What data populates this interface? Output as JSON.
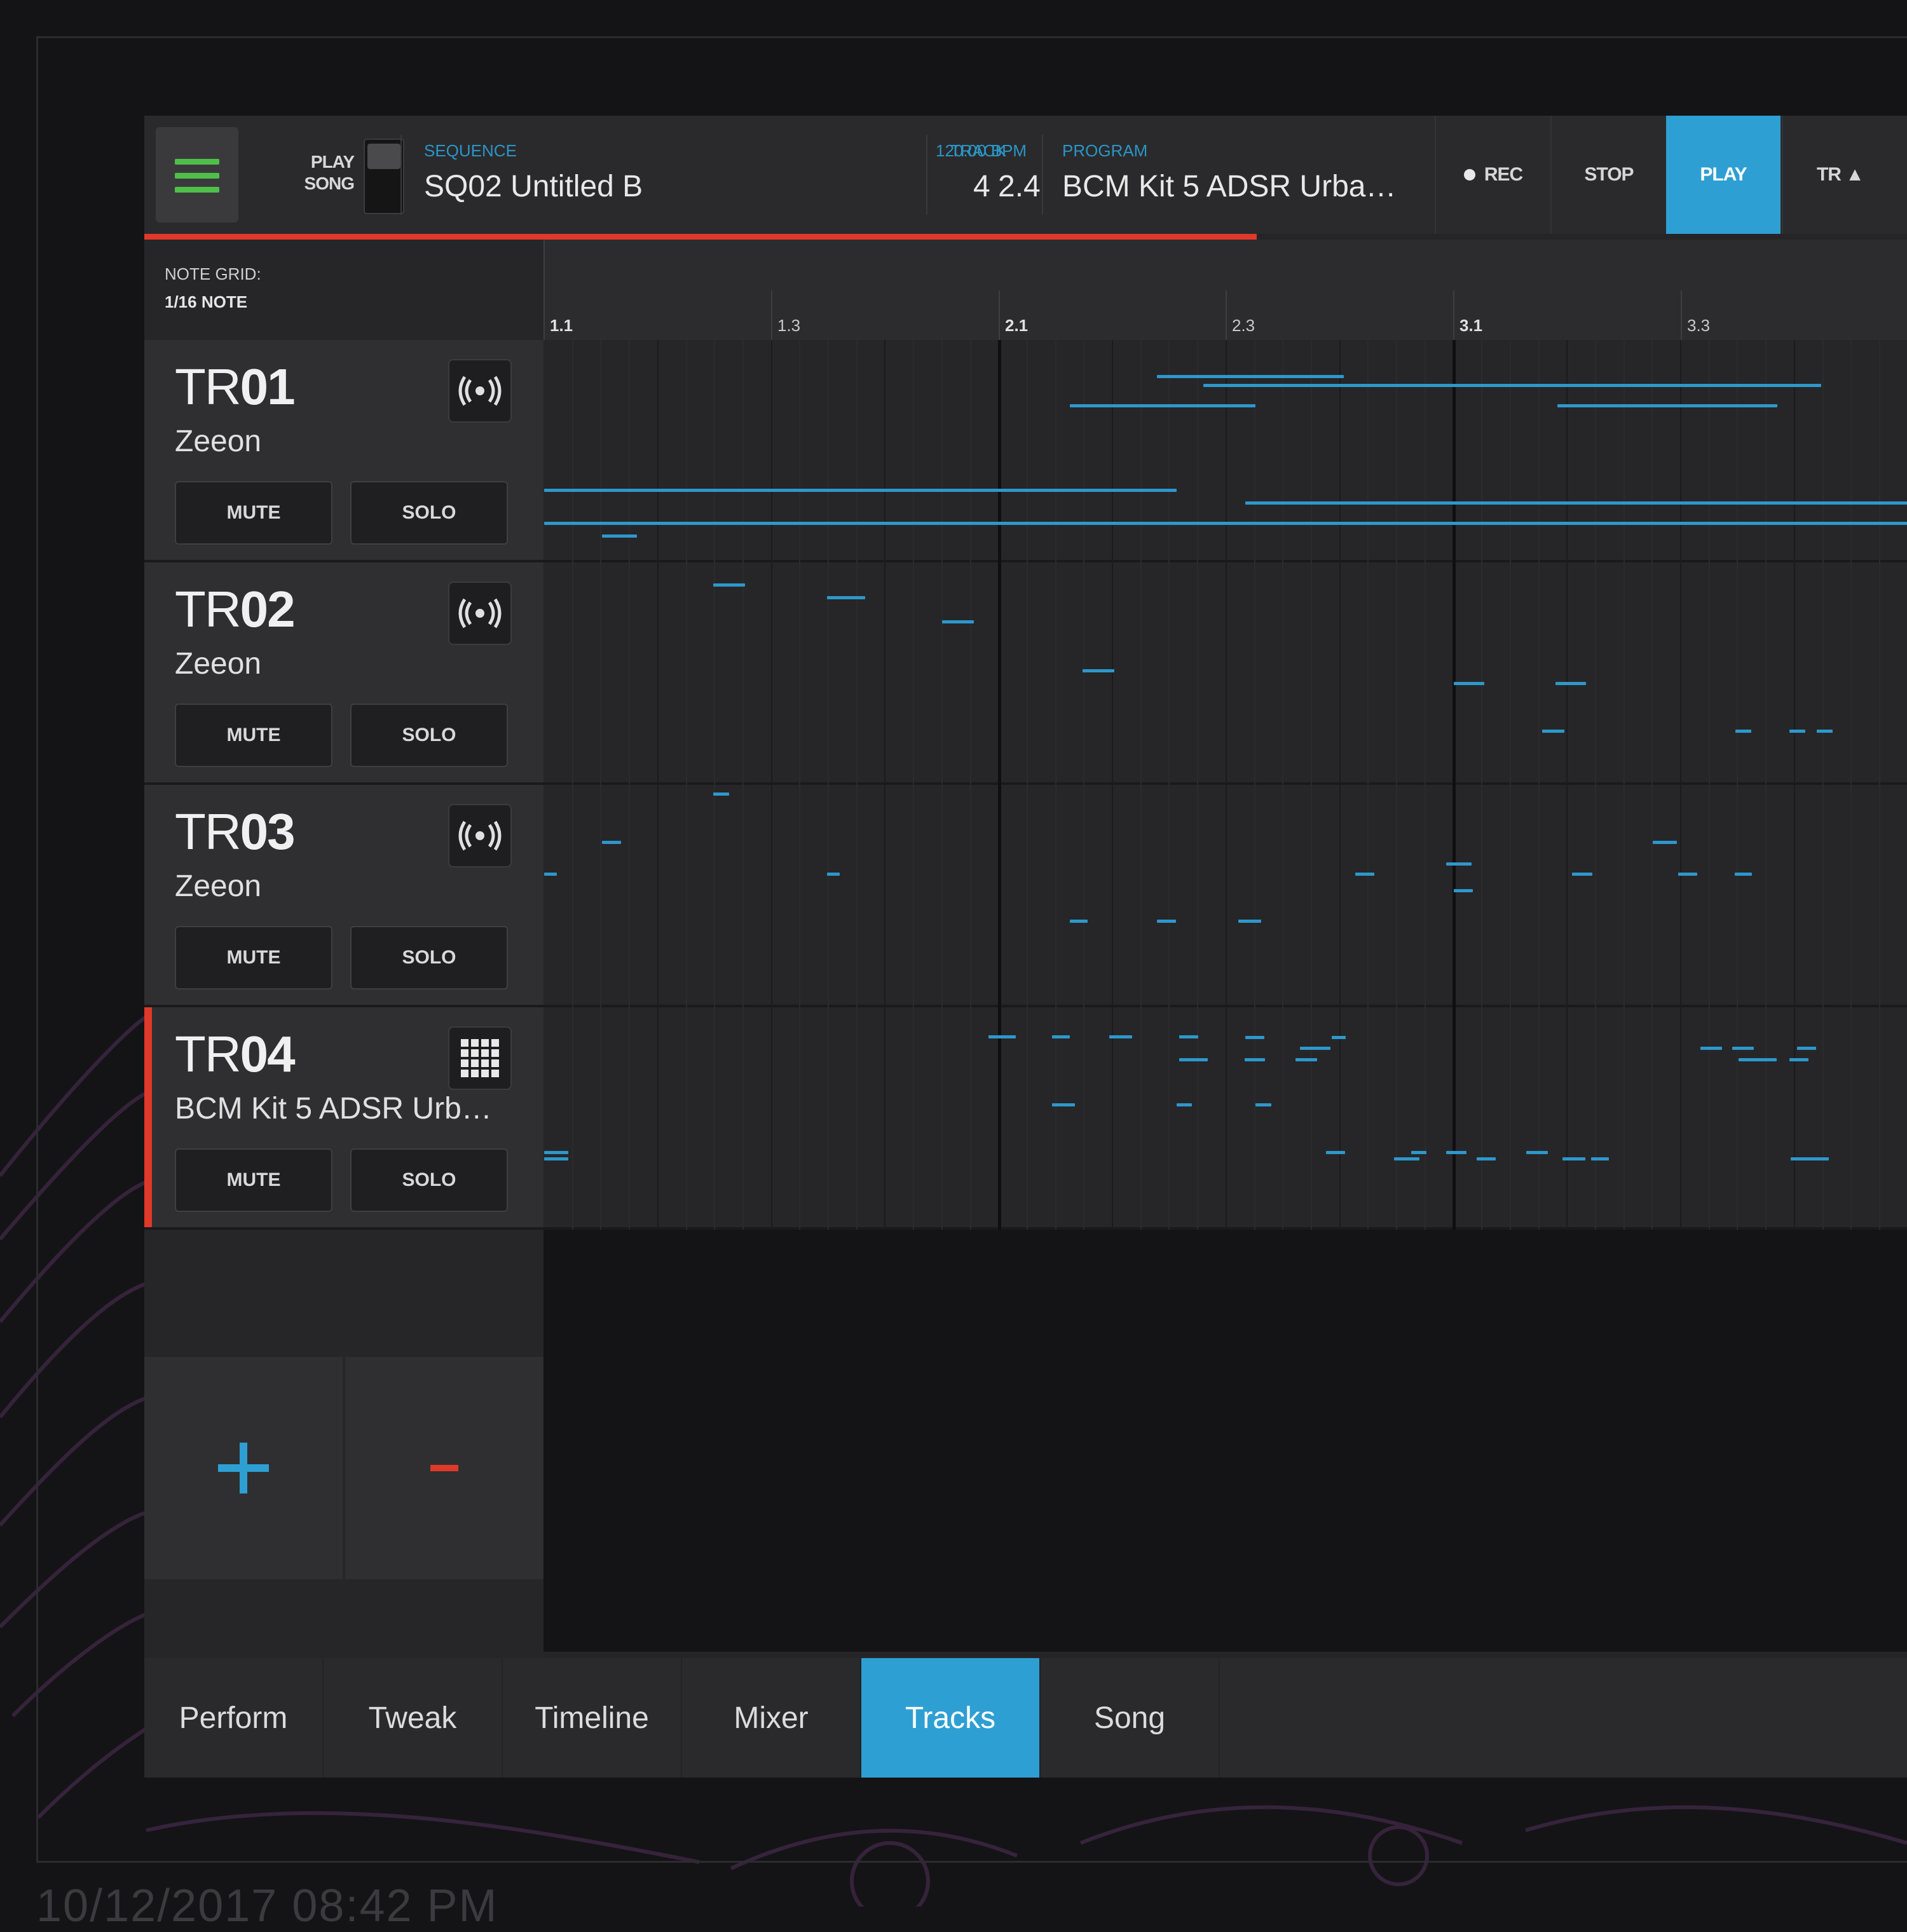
{
  "header": {
    "play_song_line1": "PLAY",
    "play_song_line2": "SONG",
    "sequence_caption": "SEQUENCE",
    "sequence_name": "SQ02 Untitled B",
    "bpm_caption": "120.00 BPM",
    "position": "2.4",
    "track_caption": "TRACK",
    "track_number": "4",
    "program_caption": "PROGRAM",
    "program_name": "BCM Kit 5 ADSR Urba…",
    "rec_label": "REC",
    "stop_label": "STOP",
    "play_label": "PLAY",
    "tr_label": "TR ▲"
  },
  "note_grid": {
    "caption": "NOTE GRID:",
    "value": "1/16 NOTE"
  },
  "ruler": {
    "labels": [
      "1.1",
      "1.3",
      "2.1",
      "2.3",
      "3.1",
      "3.3"
    ]
  },
  "tracks": [
    {
      "prefix": "TR",
      "num": "01",
      "program": "Zeeon",
      "icon": "synth-wave-icon",
      "mute": "MUTE",
      "solo": "SOLO"
    },
    {
      "prefix": "TR",
      "num": "02",
      "program": "Zeeon",
      "icon": "synth-wave-icon",
      "mute": "MUTE",
      "solo": "SOLO"
    },
    {
      "prefix": "TR",
      "num": "03",
      "program": "Zeeon",
      "icon": "synth-wave-icon",
      "mute": "MUTE",
      "solo": "SOLO"
    },
    {
      "prefix": "TR",
      "num": "04",
      "program": "BCM Kit 5 ADSR Urb…",
      "icon": "drum-pad-grid-icon",
      "mute": "MUTE",
      "solo": "SOLO"
    }
  ],
  "add_track_icon": "plus-icon",
  "remove_track_icon": "minus-icon",
  "tabs": [
    "Perform",
    "Tweak",
    "Timeline",
    "Mixer",
    "Tracks",
    "Song"
  ],
  "active_tab": "Tracks",
  "footer_date": "10/12/2017 08:42 PM",
  "colors": {
    "accent": "#2e9fd3",
    "record_red": "#e0392a",
    "note_blue": "#2d98cc",
    "menu_green": "#4fbf4a"
  }
}
